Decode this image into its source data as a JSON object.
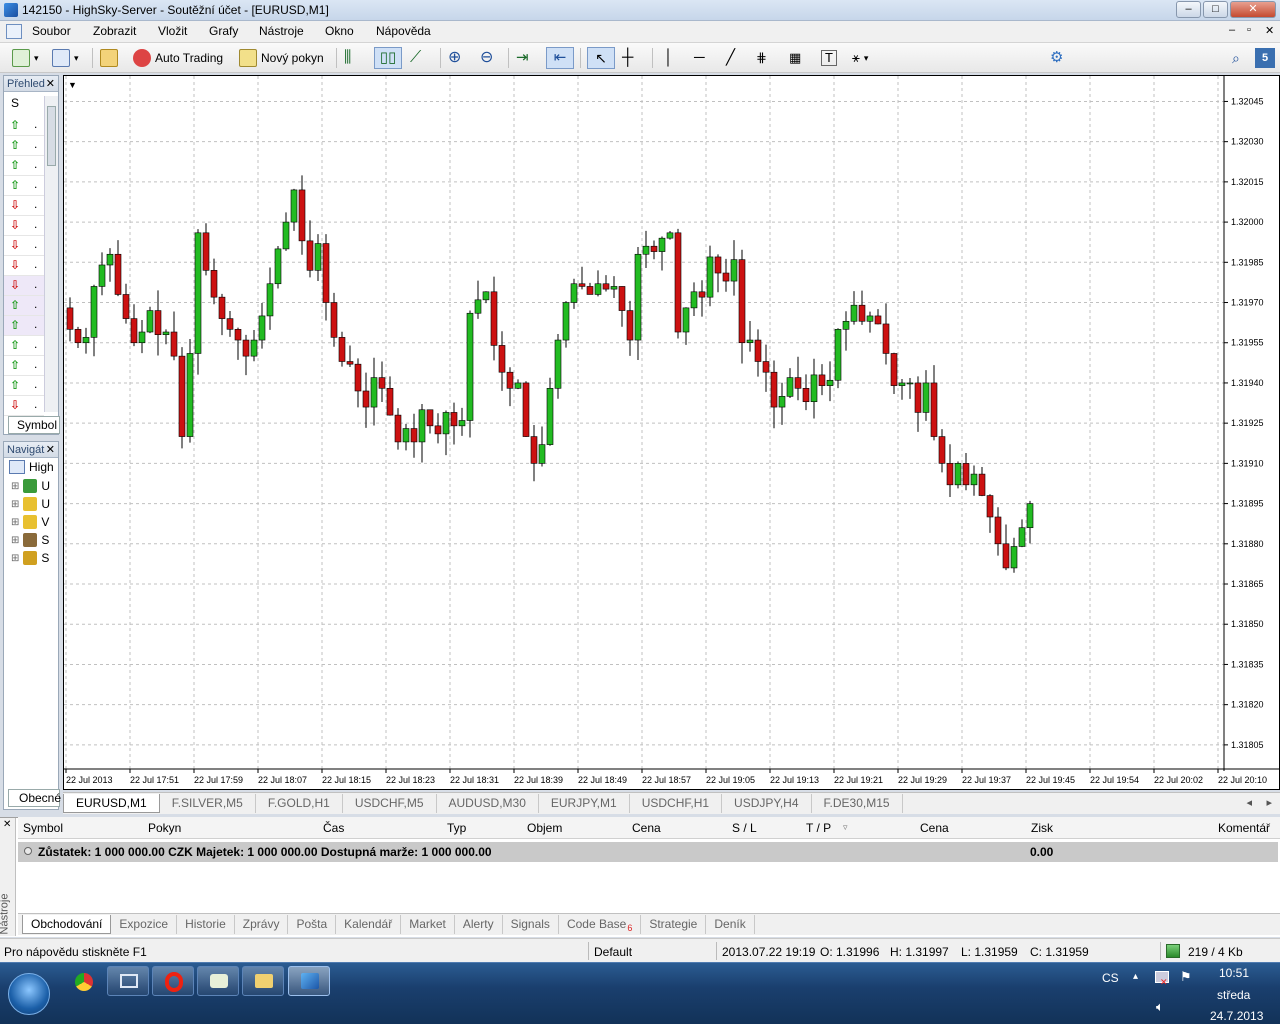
{
  "window": {
    "title": "142150 - HighSky-Server - Soutěžní účet - [EURUSD,M1]"
  },
  "menu": [
    "Soubor",
    "Zobrazit",
    "Vložit",
    "Grafy",
    "Nástroje",
    "Okno",
    "Nápověda"
  ],
  "toolbar": {
    "auto_trading": "Auto Trading",
    "new_order": "Nový pokyn",
    "search_placeholder": ""
  },
  "market_watch": {
    "title": "Přehled",
    "col_symbol": "S",
    "tab": "Symbol",
    "arrows": [
      "up",
      "up",
      "up",
      "up",
      "down",
      "down",
      "down",
      "down",
      "down",
      "up",
      "up",
      "up",
      "up",
      "up",
      "down"
    ]
  },
  "navigator": {
    "title": "Navigát",
    "root": "High",
    "items": [
      "U",
      "U",
      "V",
      "S",
      "S"
    ],
    "tab": "Obecné"
  },
  "chart_data": {
    "type": "candlestick",
    "symbol": "EURUSD",
    "timeframe": "M1",
    "y_ticks": [
      "1.32045",
      "1.32030",
      "1.32015",
      "1.32000",
      "1.31985",
      "1.31970",
      "1.31955",
      "1.31940",
      "1.31925",
      "1.31910",
      "1.31895",
      "1.31880",
      "1.31865",
      "1.31850",
      "1.31835",
      "1.31820",
      "1.31805"
    ],
    "ylim": [
      1.31796,
      1.32053
    ],
    "x_ticks": [
      "22 Jul 2013",
      "22 Jul 17:51",
      "22 Jul 17:59",
      "22 Jul 18:07",
      "22 Jul 18:15",
      "22 Jul 18:23",
      "22 Jul 18:31",
      "22 Jul 18:39",
      "22 Jul 18:49",
      "22 Jul 18:57",
      "22 Jul 19:05",
      "22 Jul 19:13",
      "22 Jul 19:21",
      "22 Jul 19:29",
      "22 Jul 19:37",
      "22 Jul 19:45",
      "22 Jul 19:54",
      "22 Jul 20:02",
      "22 Jul 20:10"
    ],
    "closes": [
      1.3196,
      1.31955,
      1.31957,
      1.31976,
      1.31984,
      1.31988,
      1.31973,
      1.31964,
      1.31955,
      1.31959,
      1.31967,
      1.31958,
      1.31959,
      1.3195,
      1.3192,
      1.31951,
      1.31996,
      1.31982,
      1.31972,
      1.31964,
      1.3196,
      1.31956,
      1.3195,
      1.31956,
      1.31965,
      1.31977,
      1.3199,
      1.32,
      1.32012,
      1.31993,
      1.31982,
      1.31992,
      1.3197,
      1.31957,
      1.31948,
      1.31947,
      1.31937,
      1.31931,
      1.31942,
      1.31938,
      1.31928,
      1.31918,
      1.31923,
      1.31918,
      1.3193,
      1.31924,
      1.31921,
      1.31929,
      1.31924,
      1.31926,
      1.31966,
      1.31971,
      1.31974,
      1.31954,
      1.31944,
      1.31938,
      1.3194,
      1.3192,
      1.3191,
      1.31917,
      1.31938,
      1.31956,
      1.3197,
      1.31977,
      1.31976,
      1.31973,
      1.31977,
      1.31975,
      1.31976,
      1.31967,
      1.31956,
      1.31988,
      1.31991,
      1.31989,
      1.31994,
      1.31996,
      1.31959,
      1.31968,
      1.31974,
      1.31972,
      1.31987,
      1.31981,
      1.31978,
      1.31986,
      1.31955,
      1.31956,
      1.31948,
      1.31944,
      1.31931,
      1.31935,
      1.31942,
      1.31938,
      1.31933,
      1.31943,
      1.31939,
      1.31941,
      1.3196,
      1.31963,
      1.31969,
      1.31963,
      1.31965,
      1.31962,
      1.31951,
      1.31939,
      1.3194,
      1.3194,
      1.31929,
      1.3194,
      1.3192,
      1.3191,
      1.31902,
      1.3191,
      1.31902,
      1.31906,
      1.31898,
      1.3189,
      1.3188,
      1.31871,
      1.31879,
      1.31886,
      1.31895
    ],
    "last_close": "1.31959"
  },
  "chart_tabs": [
    "EURUSD,M1",
    "F.SILVER,M5",
    "F.GOLD,H1",
    "USDCHF,M5",
    "AUDUSD,M30",
    "EURJPY,M1",
    "USDCHF,H1",
    "USDJPY,H4",
    "F.DE30,M15"
  ],
  "terminal": {
    "columns": [
      "Symbol",
      "Pokyn",
      "Čas",
      "Typ",
      "Objem",
      "Cena",
      "S / L",
      "T / P",
      "Cena",
      "Zisk",
      "Komentář"
    ],
    "balance_text": "Zůstatek: 1 000 000.00 CZK  Majetek: 1 000 000.00  Dostupná marže: 1 000 000.00",
    "profit": "0.00",
    "side_label": "Nástroje",
    "tabs": [
      "Obchodování",
      "Expozice",
      "Historie",
      "Zprávy",
      "Pošta",
      "Kalendář",
      "Market",
      "Alerty",
      "Signals",
      "Code Base",
      "Strategie",
      "Deník"
    ],
    "code_base_badge": "6"
  },
  "status": {
    "help": "Pro nápovědu stiskněte F1",
    "profile": "Default",
    "datetime": "2013.07.22 19:19",
    "open": "O: 1.31996",
    "high": "H: 1.31997",
    "low": "L: 1.31959",
    "close": "C: 1.31959",
    "traffic": "219 / 4 Kb"
  },
  "taskbar": {
    "lang": "CS",
    "time": "10:51",
    "day": "středa",
    "date": "24.7.2013"
  },
  "colors": {
    "bull": "#22bb22",
    "bear": "#cc1111",
    "grid": "#c0c0c0"
  }
}
